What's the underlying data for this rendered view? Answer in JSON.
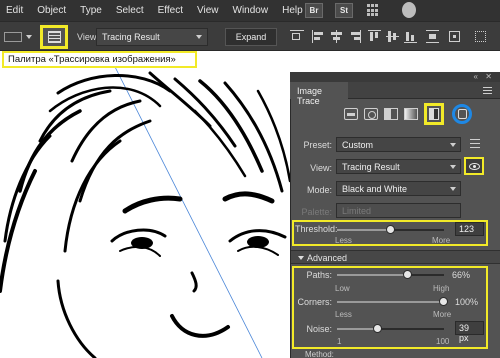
{
  "menu": {
    "items": [
      "Edit",
      "Object",
      "Type",
      "Select",
      "Effect",
      "View",
      "Window",
      "Help"
    ],
    "bridge_label": "Br",
    "stock_label": "St"
  },
  "control_bar": {
    "view_label": "View:",
    "view_value": "Tracing Result",
    "expand_label": "Expand"
  },
  "tooltip": {
    "text": "Палитра «Трассировка изображения»"
  },
  "panel": {
    "title": "Image Trace",
    "preset_label": "Preset:",
    "preset_value": "Custom",
    "view_label": "View:",
    "view_value": "Tracing Result",
    "mode_label": "Mode:",
    "mode_value": "Black and White",
    "palette_label": "Palette:",
    "palette_value": "Limited",
    "threshold": {
      "label": "Threshold:",
      "value": "123",
      "level": 0.5,
      "min_label": "Less",
      "max_label": "More"
    },
    "advanced_label": "Advanced",
    "paths": {
      "label": "Paths:",
      "value": "66%",
      "level": 0.66,
      "min_label": "Low",
      "max_label": "High"
    },
    "corners": {
      "label": "Corners:",
      "value": "100%",
      "level": 1.0,
      "min_label": "Less",
      "max_label": "More"
    },
    "noise": {
      "label": "Noise:",
      "value": "39 px",
      "level": 0.38,
      "min_label": "1",
      "max_label": "100"
    },
    "method_label": "Method:"
  },
  "colors": {
    "highlight": "#f2ea28",
    "circle": "#1e88e5",
    "panel_bg": "#535353",
    "menubar_bg": "#323232"
  }
}
